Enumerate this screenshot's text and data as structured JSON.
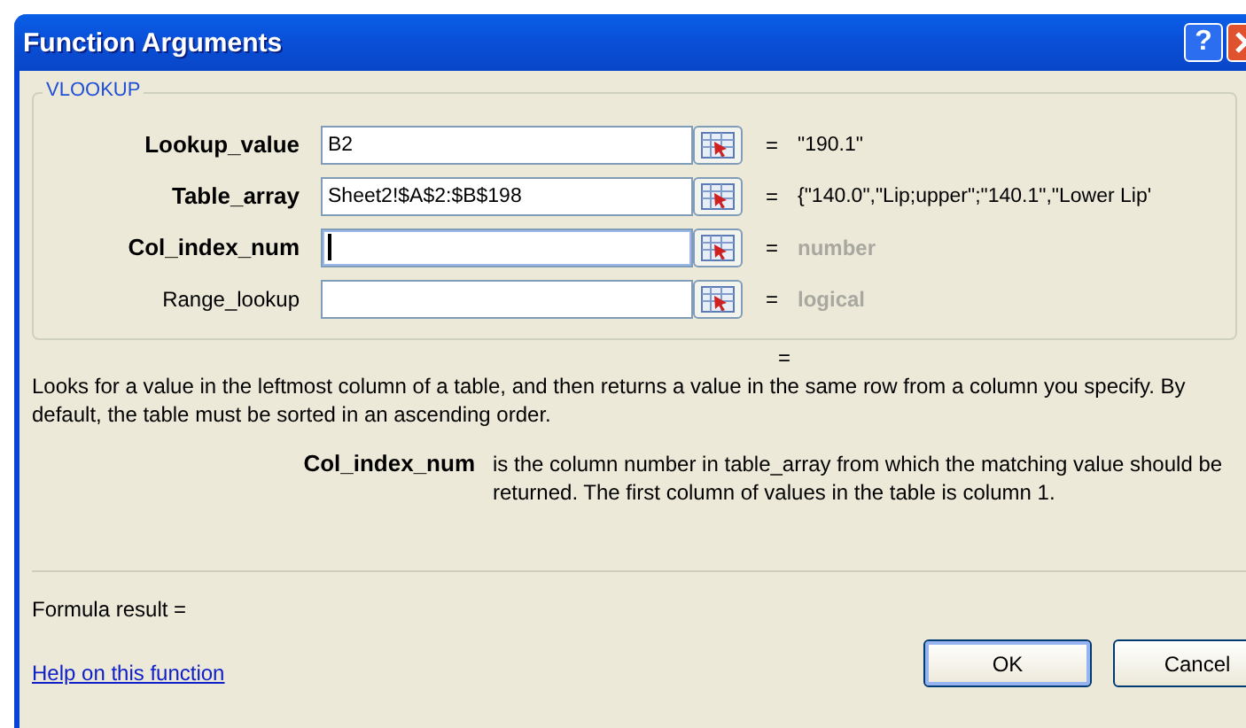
{
  "window": {
    "title": "Function Arguments"
  },
  "function_name": "VLOOKUP",
  "arguments": [
    {
      "label": "Lookup_value",
      "bold": true,
      "value": "B2",
      "focused": false,
      "equals": "=",
      "result": "\"190.1\"",
      "hint": false
    },
    {
      "label": "Table_array",
      "bold": true,
      "value": "Sheet2!$A$2:$B$198",
      "focused": false,
      "equals": "=",
      "result": "{\"140.0\",\"Lip;upper\";\"140.1\",\"Lower Lip'",
      "hint": false
    },
    {
      "label": "Col_index_num",
      "bold": true,
      "focused": true,
      "equals": "=",
      "result": "number",
      "hint": true
    },
    {
      "label": "Range_lookup",
      "bold": false,
      "focused": false,
      "equals": "=",
      "result": "logical",
      "hint": true
    }
  ],
  "function_result": "=",
  "description": "Looks for a value in the leftmost column of a table, and then returns a value in the same row from a column you specify. By default, the table must be sorted in an ascending order.",
  "argument_help": {
    "name": "Col_index_num",
    "text": "is the column number in table_array from which the matching value should be returned. The first column of values in the table is column 1."
  },
  "formula_result": "Formula result =",
  "help_link": "Help on this function",
  "buttons": [
    {
      "label": "OK",
      "default": true
    },
    {
      "label": "Cancel",
      "default": false
    }
  ],
  "title_buttons": [
    "?"
  ]
}
